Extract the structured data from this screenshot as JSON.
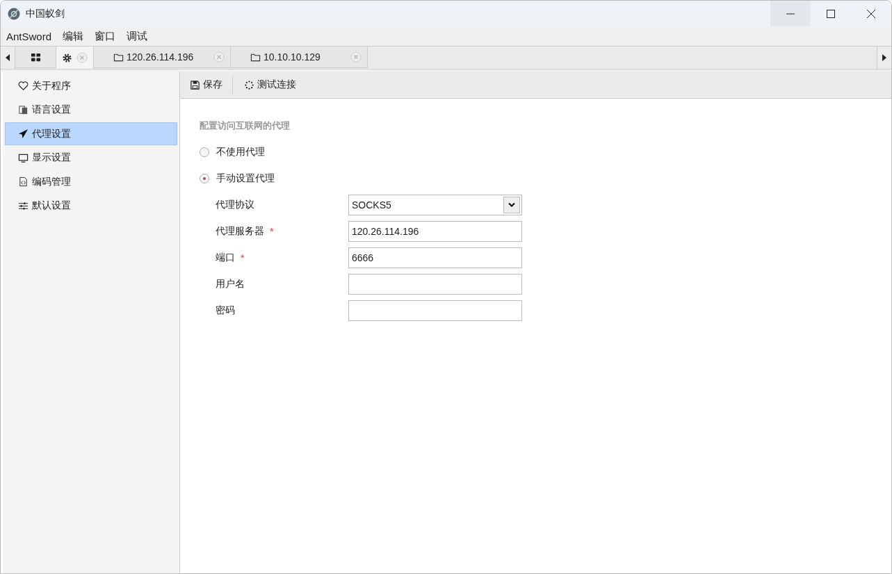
{
  "window": {
    "title": "中国蚁剑"
  },
  "menu": [
    "AntSword",
    "编辑",
    "窗口",
    "调试"
  ],
  "tabs": [
    {
      "kind": "grid",
      "selected": false,
      "closable": false
    },
    {
      "kind": "settings",
      "selected": true,
      "closable": true
    },
    {
      "kind": "folder",
      "label": "120.26.114.196",
      "selected": false,
      "closable": true
    },
    {
      "kind": "folder",
      "label": "10.10.10.129",
      "selected": false,
      "closable": true
    }
  ],
  "sidebar": {
    "items": [
      {
        "label": "关于程序",
        "selected": false
      },
      {
        "label": "语言设置",
        "selected": false
      },
      {
        "label": "代理设置",
        "selected": true
      },
      {
        "label": "显示设置",
        "selected": false
      },
      {
        "label": "编码管理",
        "selected": false
      },
      {
        "label": "默认设置",
        "selected": false
      }
    ]
  },
  "toolbar": [
    {
      "label": "保存"
    },
    {
      "label": "测试连接"
    }
  ],
  "form": {
    "title": "配置访问互联网的代理",
    "options": [
      {
        "label": "不使用代理",
        "selected": false
      },
      {
        "label": "手动设置代理",
        "selected": true
      }
    ],
    "fields": [
      {
        "kind": "select",
        "label": "代理协议",
        "value": "SOCKS5"
      },
      {
        "kind": "text",
        "label": "代理服务器",
        "required_mark": "*",
        "value": "120.26.114.196"
      },
      {
        "kind": "text",
        "label": "端口",
        "required_mark": "*",
        "value": "6666"
      },
      {
        "kind": "text",
        "label": "用户名"
      },
      {
        "kind": "password",
        "label": "密码"
      }
    ]
  }
}
